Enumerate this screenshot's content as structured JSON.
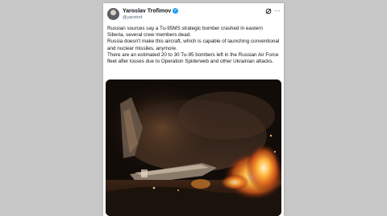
{
  "tweet": {
    "author_name": "Yaroslav Trofimov",
    "author_handle": "@yarotrof",
    "verified": true,
    "icons": {
      "grok": "grok-icon",
      "more": "more-options-icon",
      "verified": "verified-badge-icon"
    },
    "paragraphs": [
      "Russian sources say a Tu-95MS strategic bomber crashed in eastern Siberia, several crew members dead.",
      "Russia doesn't make this aircraft, which is capable of launching conventional and nuclear missiles, anymore.",
      "There are an estimated 20 to 30 Tu-95 bombers left in the Russian Air Force fleet after losses due to Operation Spiderweb and other Ukrainian attacks."
    ]
  },
  "colors": {
    "verified": "#1d9bf0",
    "background": "#c7c7c7"
  }
}
